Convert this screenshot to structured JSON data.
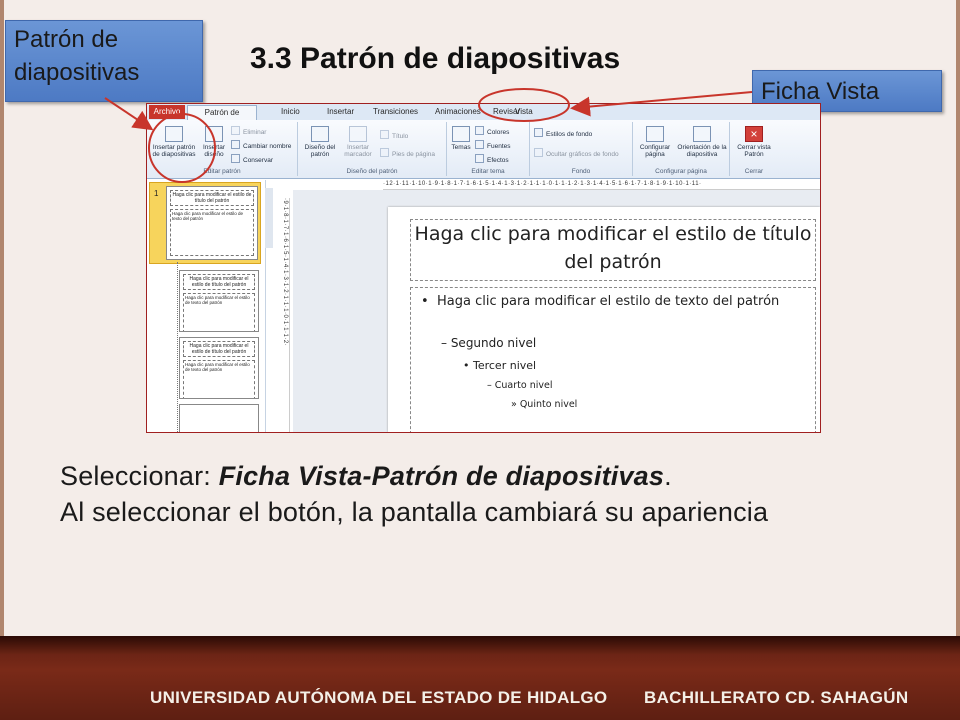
{
  "slide": {
    "title": "3.3 Patrón de diapositivas",
    "callout_left": "Patrón de diapositivas",
    "callout_right": "Ficha Vista",
    "body_prefix": "Seleccionar: ",
    "body_emphasis": "Ficha Vista-Patrón de diapositivas",
    "body_suffix": ".",
    "body_line2": "Al seleccionar el botón, la pantalla cambiará su apariencia",
    "footer_left": "UNIVERSIDAD AUTÓNOMA DEL ESTADO DE HIDALGO",
    "footer_right": "BACHILLERATO CD. SAHAGÚN",
    "colors": {
      "callout": "#5a86cc",
      "highlight": "#c8352b",
      "footer": "#6e2516"
    }
  },
  "ribbon": {
    "tabs": [
      "Archivo",
      "Patrón de diapositivas",
      "Inicio",
      "Insertar",
      "Transiciones",
      "Animaciones",
      "Revisar",
      "Vista"
    ],
    "groups": {
      "editar_patron": {
        "label": "Editar patrón",
        "insert_master": "Insertar patrón de diapositivas",
        "insert_layout": "Insertar diseño",
        "delete": "Eliminar",
        "rename": "Cambiar nombre",
        "preserve": "Conservar"
      },
      "diseno_patron": {
        "label": "Diseño del patrón",
        "master_layout": "Diseño del patrón",
        "insert_placeholder": "Insertar marcador",
        "title_check": "Título",
        "footers_check": "Pies de página"
      },
      "editar_tema": {
        "label": "Editar tema",
        "themes": "Temas",
        "colors": "Colores",
        "fonts": "Fuentes",
        "effects": "Efectos"
      },
      "fondo": {
        "label": "Fondo",
        "bg_styles": "Estilos de fondo",
        "hide_bg": "Ocultar gráficos de fondo"
      },
      "configurar": {
        "label": "Configurar página",
        "page_setup": "Configurar página",
        "orientation": "Orientación de la diapositiva"
      },
      "cerrar": {
        "label": "Cerrar",
        "close_view": "Cerrar vista Patrón"
      }
    }
  },
  "rulers": {
    "top": "·12·1·11·1·10·1·9·1·8·1·7·1·6·1·5·1·4·1·3·1·2·1·1·1·0·1·1·1·2·1·3·1·4·1·5·1·6·1·7·1·8·1·9·1·10·1·11·",
    "left": "·9·1·8·1·7·1·6·1·5·1·4·1·3·1·2·1·1·1·0·1·1·1·2·"
  },
  "thumbnails": {
    "number": "1",
    "title": "Haga clic para modificar el estilo de título del patrón",
    "body": "Haga clic para modificar el estilo de texto del patrón"
  },
  "master": {
    "title": "Haga clic para modificar el estilo de título del patrón",
    "bullet": "•",
    "level1": "Haga clic para modificar el estilo de texto del patrón",
    "level2": "– Segundo nivel",
    "level3": "• Tercer nivel",
    "level4": "– Cuarto nivel",
    "level5": "» Quinto nivel"
  }
}
